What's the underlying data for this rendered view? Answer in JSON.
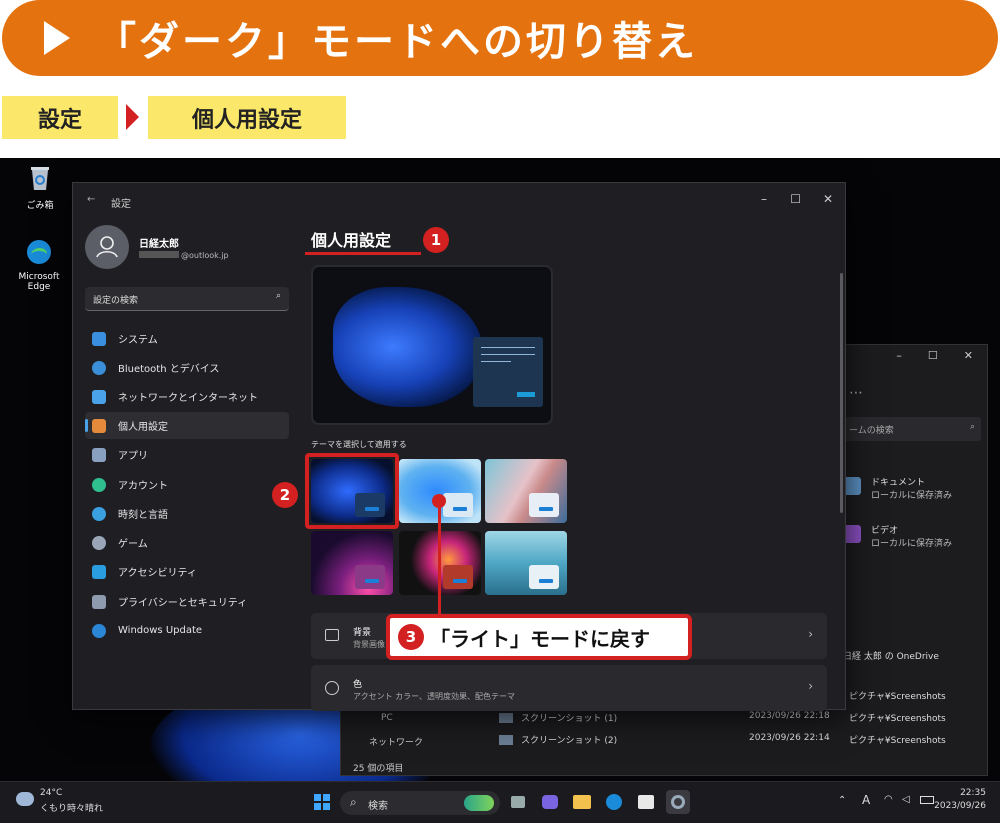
{
  "banner": {
    "title": "「ダーク」モードへの切り替え"
  },
  "breadcrumb": {
    "step1": "設定",
    "step2": "個人用設定"
  },
  "desktop": {
    "recycle_bin": "ごみ箱",
    "edge": "Microsoft Edge"
  },
  "settings": {
    "app_title": "設定",
    "user": {
      "name": "日経太郎",
      "email": "@outlook.jp"
    },
    "search_placeholder": "設定の検索",
    "sidebar": [
      {
        "label": "システム",
        "color": "#3b8fe0"
      },
      {
        "label": "Bluetooth とデバイス",
        "color": "#3a8fd8"
      },
      {
        "label": "ネットワークとインターネット",
        "color": "#4aa3e8"
      },
      {
        "label": "個人用設定",
        "color": "#e58a3a"
      },
      {
        "label": "アプリ",
        "color": "#8aa0c0"
      },
      {
        "label": "アカウント",
        "color": "#2fbf8f"
      },
      {
        "label": "時刻と言語",
        "color": "#3aa0e0"
      },
      {
        "label": "ゲーム",
        "color": "#9aa6b8"
      },
      {
        "label": "アクセシビリティ",
        "color": "#2a9ce0"
      },
      {
        "label": "プライバシーとセキュリティ",
        "color": "#8e9aae"
      },
      {
        "label": "Windows Update",
        "color": "#2b86d6"
      }
    ],
    "page_title": "個人用設定",
    "theme_section_label": "テーマを選択して適用する",
    "cards": [
      {
        "title": "背景",
        "subtitle": "背景画像"
      },
      {
        "title": "色",
        "subtitle": "アクセント カラー、透明度効果、配色テーマ"
      }
    ]
  },
  "explorer": {
    "search_placeholder": "ームの検索",
    "quick": [
      {
        "name": "ドキュメント",
        "sub": "ローカルに保存済み"
      },
      {
        "name": "ビデオ",
        "sub": "ローカルに保存済み"
      }
    ],
    "onedrive": "日経 太郎 の OneDrive",
    "tree": [
      "PC",
      "ネットワーク"
    ],
    "rows": [
      {
        "name": "",
        "date": "",
        "path": "ピクチャ¥Screenshots"
      },
      {
        "name": "スクリーンショット (1)",
        "date": "2023/09/26 22:18",
        "path": "ピクチャ¥Screenshots"
      },
      {
        "name": "スクリーンショット (2)",
        "date": "2023/09/26 22:14",
        "path": "ピクチャ¥Screenshots"
      }
    ],
    "item_count": "25 個の項目"
  },
  "callouts": {
    "n1": "1",
    "n2": "2",
    "n3": "3",
    "c3": "「ライト」モードに戻す"
  },
  "taskbar": {
    "temp": "24°C",
    "weather": "くもり時々晴れ",
    "search": "検索",
    "ime": "A",
    "time": "22:35",
    "date": "2023/09/26"
  }
}
